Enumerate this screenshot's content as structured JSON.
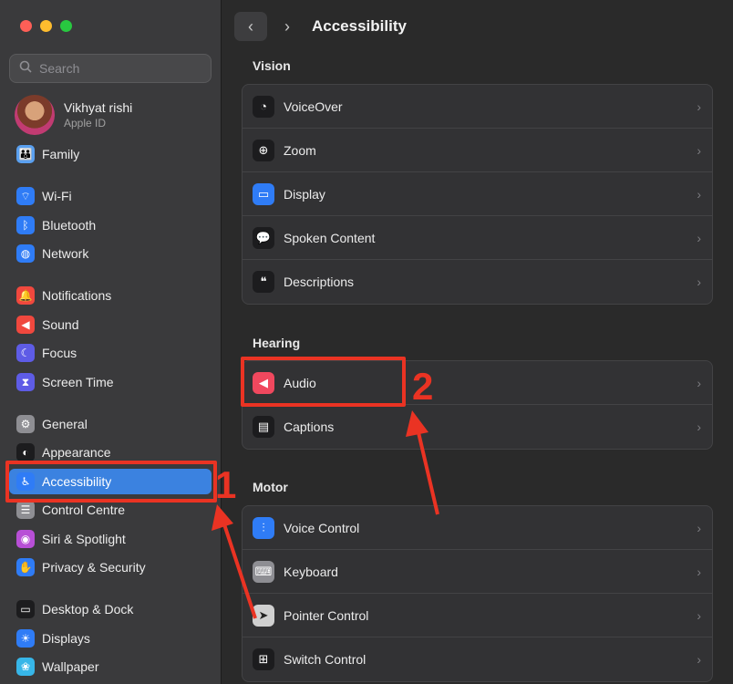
{
  "search": {
    "placeholder": "Search"
  },
  "profile": {
    "name": "Vikhyat rishi",
    "subtitle": "Apple ID"
  },
  "sidebar": {
    "items": [
      {
        "label": "Family",
        "icon": "family-icon",
        "color": "#5aa0f0",
        "glyph": "👪"
      },
      {
        "label": "Wi-Fi",
        "icon": "wifi-icon",
        "color": "#2f7cf6",
        "glyph": "⌔"
      },
      {
        "label": "Bluetooth",
        "icon": "bluetooth-icon",
        "color": "#2f7cf6",
        "glyph": "ᛒ"
      },
      {
        "label": "Network",
        "icon": "globe-icon",
        "color": "#2f7cf6",
        "glyph": "◍"
      },
      {
        "label": "Notifications",
        "icon": "bell-icon",
        "color": "#f0483e",
        "glyph": "🔔"
      },
      {
        "label": "Sound",
        "icon": "speaker-icon",
        "color": "#f0483e",
        "glyph": "◀"
      },
      {
        "label": "Focus",
        "icon": "moon-icon",
        "color": "#5e5ce6",
        "glyph": "☾"
      },
      {
        "label": "Screen Time",
        "icon": "hourglass-icon",
        "color": "#5e5ce6",
        "glyph": "⧗"
      },
      {
        "label": "General",
        "icon": "gear-icon",
        "color": "#8e8e93",
        "glyph": "⚙"
      },
      {
        "label": "Appearance",
        "icon": "appearance-icon",
        "color": "#1c1c1e",
        "glyph": "◐"
      },
      {
        "label": "Accessibility",
        "icon": "accessibility-icon",
        "color": "#2f7cf6",
        "glyph": "♿"
      },
      {
        "label": "Control Centre",
        "icon": "toggles-icon",
        "color": "#8e8e93",
        "glyph": "☰"
      },
      {
        "label": "Siri & Spotlight",
        "icon": "siri-icon",
        "color": "#b84fd6",
        "glyph": "◉"
      },
      {
        "label": "Privacy & Security",
        "icon": "hand-icon",
        "color": "#2f7cf6",
        "glyph": "✋"
      },
      {
        "label": "Desktop & Dock",
        "icon": "dock-icon",
        "color": "#1c1c1e",
        "glyph": "▭"
      },
      {
        "label": "Displays",
        "icon": "sun-icon",
        "color": "#2f7cf6",
        "glyph": "☀"
      },
      {
        "label": "Wallpaper",
        "icon": "flower-icon",
        "color": "#37b6e8",
        "glyph": "❀"
      }
    ]
  },
  "main": {
    "title": "Accessibility",
    "sections": [
      {
        "title": "Vision",
        "rows": [
          {
            "label": "VoiceOver",
            "icon": "voiceover-icon",
            "color": "#1c1c1e",
            "glyph": "◔"
          },
          {
            "label": "Zoom",
            "icon": "zoom-icon",
            "color": "#1c1c1e",
            "glyph": "⊕"
          },
          {
            "label": "Display",
            "icon": "display-icon",
            "color": "#2f7cf6",
            "glyph": "▭"
          },
          {
            "label": "Spoken Content",
            "icon": "speech-bubble-icon",
            "color": "#1c1c1e",
            "glyph": "💬"
          },
          {
            "label": "Descriptions",
            "icon": "descriptions-icon",
            "color": "#1c1c1e",
            "glyph": "❝"
          }
        ]
      },
      {
        "title": "Hearing",
        "rows": [
          {
            "label": "Audio",
            "icon": "audio-icon",
            "color": "#f0485e",
            "glyph": "◀"
          },
          {
            "label": "Captions",
            "icon": "captions-icon",
            "color": "#1c1c1e",
            "glyph": "▤"
          }
        ]
      },
      {
        "title": "Motor",
        "rows": [
          {
            "label": "Voice Control",
            "icon": "waveform-icon",
            "color": "#2f7cf6",
            "glyph": "⫶"
          },
          {
            "label": "Keyboard",
            "icon": "keyboard-icon",
            "color": "#8e8e93",
            "glyph": "⌨"
          },
          {
            "label": "Pointer Control",
            "icon": "pointer-icon",
            "color": "#d0d0d0",
            "glyph": "➤"
          },
          {
            "label": "Switch Control",
            "icon": "switch-grid-icon",
            "color": "#1c1c1e",
            "glyph": "⊞"
          }
        ]
      }
    ]
  },
  "annotations": {
    "step1": "1",
    "step2": "2",
    "color": "#ea3323"
  }
}
